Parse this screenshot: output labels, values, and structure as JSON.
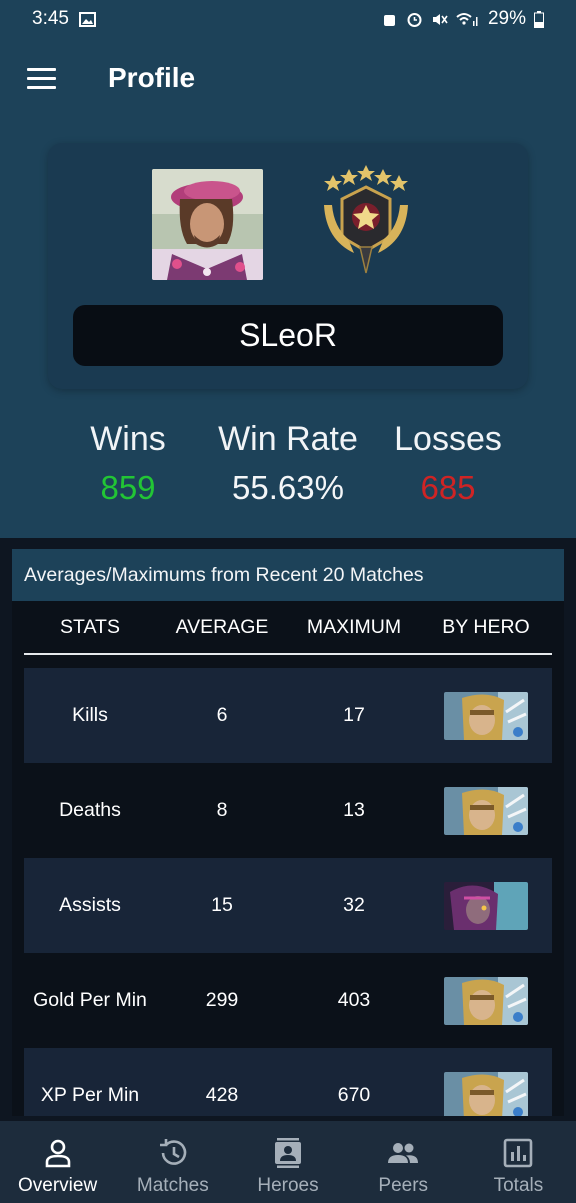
{
  "status_bar": {
    "time": "3:45",
    "battery": "29%"
  },
  "app_bar": {
    "title": "Profile"
  },
  "profile": {
    "name": "SLeoR"
  },
  "summary": {
    "wins_label": "Wins",
    "wins_value": "859",
    "winrate_label": "Win Rate",
    "winrate_value": "55.63%",
    "losses_label": "Losses",
    "losses_value": "685"
  },
  "table": {
    "title": "Averages/Maximums from Recent 20 Matches",
    "headers": [
      "STATS",
      "AVERAGE",
      "MAXIMUM",
      "BY HERO"
    ],
    "rows": [
      {
        "stat": "Kills",
        "average": "6",
        "maximum": "17",
        "hero": "golden-helmet-hero"
      },
      {
        "stat": "Deaths",
        "average": "8",
        "maximum": "13",
        "hero": "golden-helmet-hero"
      },
      {
        "stat": "Assists",
        "average": "15",
        "maximum": "32",
        "hero": "purple-hooded-hero"
      },
      {
        "stat": "Gold Per Min",
        "average": "299",
        "maximum": "403",
        "hero": "golden-helmet-hero"
      },
      {
        "stat": "XP Per Min",
        "average": "428",
        "maximum": "670",
        "hero": "golden-helmet-hero"
      }
    ]
  },
  "nav": {
    "items": [
      {
        "label": "Overview",
        "icon": "person-icon",
        "active": true
      },
      {
        "label": "Matches",
        "icon": "history-icon",
        "active": false
      },
      {
        "label": "Heroes",
        "icon": "contact-card-icon",
        "active": false
      },
      {
        "label": "Peers",
        "icon": "people-icon",
        "active": false
      },
      {
        "label": "Totals",
        "icon": "chart-icon",
        "active": false
      }
    ]
  }
}
